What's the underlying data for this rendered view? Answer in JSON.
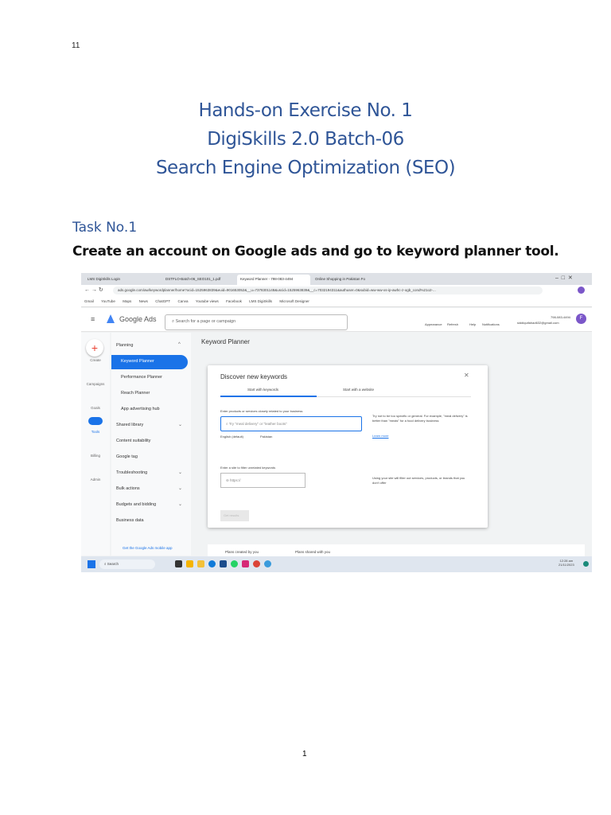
{
  "page_header_number": "11",
  "title_lines": [
    "Hands-on Exercise No. 1",
    "DigiSkills 2.0 Batch-06",
    "Search Engine Optimization (SEO)"
  ],
  "task_label": "Task No.1",
  "task_description": "Create an account on Google ads and go to keyword planner tool.",
  "page_footer_number": "1",
  "screenshot": {
    "tabs": [
      "LMS DigiSkills Login",
      "DSTFLO-Batch-06_SEO101_1.pdf",
      "Keyword Planner - 798-083-4494",
      "Online Shopping in Pakistan Fo"
    ],
    "url": "ads.google.com/aw/keywordplanner/home?ocid=1525963839&euid=901653052&__u=7378301148&uscid=1525963839&__c=7032194311&authuser=0&subid=ww-ww-xs-ip-awhc-z-ogb_cond%21o2-...",
    "bookmarks": [
      "Gmail",
      "YouTube",
      "Maps",
      "News",
      "ChatGPT",
      "Canva",
      "Youtube views",
      "Facebook",
      "LMS DigiSkills",
      "Microsoft Designer"
    ],
    "brand": "Google Ads",
    "search_placeholder": "Search for a page or campaign",
    "header_actions": [
      "Appearance",
      "Refresh",
      "Help",
      "Notifications"
    ],
    "account_id": "798-083-4494",
    "account_email": "siddiquifahad632@gmail.com",
    "avatar_letter": "F",
    "rail": [
      "Create",
      "Campaigns",
      "Goals",
      "Tools",
      "Billing",
      "Admin"
    ],
    "nav": [
      "Planning",
      "Keyword Planner",
      "Performance Planner",
      "Reach Planner",
      "App advertising hub",
      "Shared library",
      "Content suitability",
      "Google tag",
      "Troubleshooting",
      "Bulk actions",
      "Budgets and bidding",
      "Business data"
    ],
    "mobile_app_link": "Get the Google Ads mobile app",
    "page_title": "Keyword Planner",
    "dialog": {
      "title": "Discover new keywords",
      "tab1": "Start with keywords",
      "tab2": "Start with a website",
      "label1": "Enter products or services closely related to your business",
      "placeholder1": "Try \"meal delivery\" or \"leather boots\"",
      "language": "English (default)",
      "location": "Pakistan",
      "hint1": "Try not to be too specific or general. For example, \"meal delivery\" is better than \"meals\" for a food delivery business",
      "learn_more": "Learn more",
      "label2": "Enter a site to filter unrelated keywords",
      "placeholder2": "https://",
      "hint2": "Using your site will filter out services, products, or brands that you don't offer",
      "button": "Get results"
    },
    "plans_tabs": [
      "Plans created by you",
      "Plans shared with you"
    ],
    "taskbar_search": "Search",
    "time": "12:28 am",
    "date": "21/11/2023"
  }
}
